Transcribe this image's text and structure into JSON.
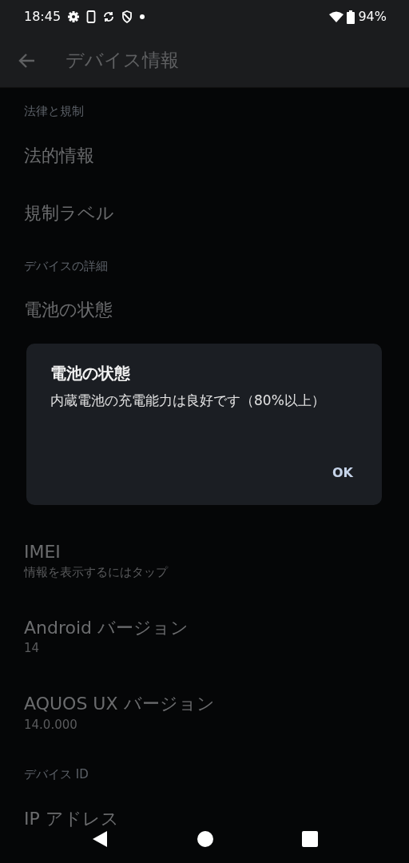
{
  "status_bar": {
    "time": "18:45",
    "battery": "94%"
  },
  "app_bar": {
    "title": "デバイス情報"
  },
  "sections": [
    {
      "header": "法律と規制",
      "items": [
        {
          "title": "法的情報"
        },
        {
          "title": "規制ラベル"
        }
      ]
    },
    {
      "header": "デバイスの詳細",
      "items": [
        {
          "title": "電池の状態"
        },
        {
          "kind": "hidden"
        },
        {
          "title": "IMEI",
          "subtitle": "情報を表示するにはタップ"
        },
        {
          "title": "Android バージョン",
          "subtitle": "14"
        },
        {
          "title": "AQUOS UX バージョン",
          "subtitle": "14.0.000"
        }
      ]
    },
    {
      "header": "デバイス ID",
      "items": [
        {
          "title": "IP アドレス"
        }
      ]
    }
  ],
  "dialog": {
    "title": "電池の状態",
    "message": "内蔵電池の充電能力は良好です（80%以上）",
    "button": "OK"
  }
}
